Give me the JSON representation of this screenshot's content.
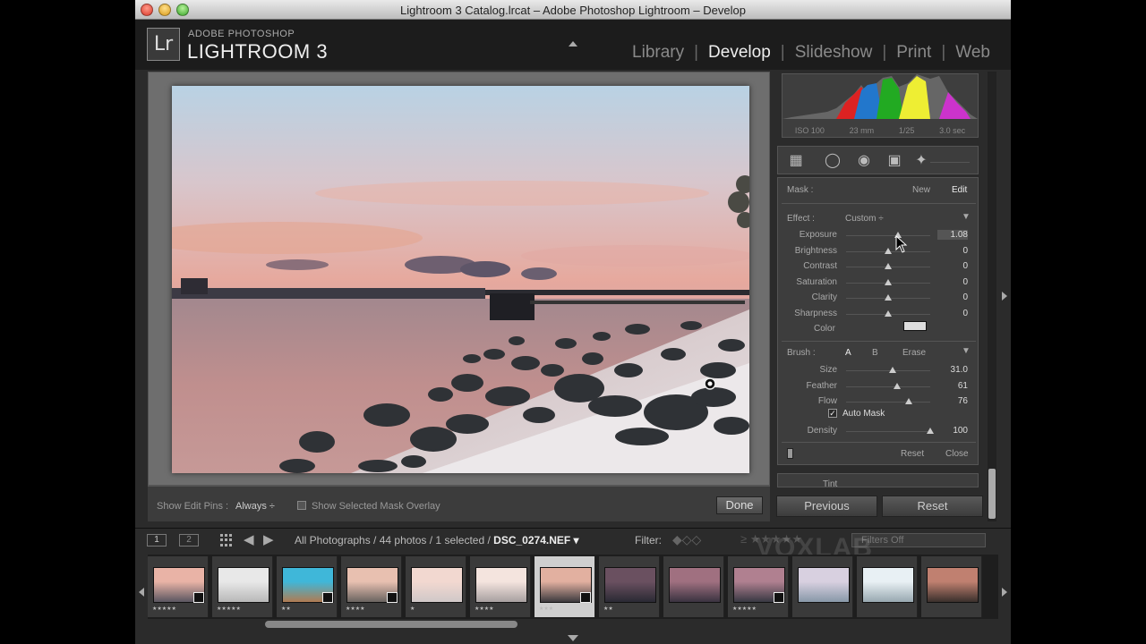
{
  "window": {
    "title": "Lightroom 3 Catalog.lrcat – Adobe Photoshop Lightroom – Develop"
  },
  "brand": {
    "logo": "Lr",
    "small": "ADOBE PHOTOSHOP",
    "big": "LIGHTROOM 3"
  },
  "modules": [
    {
      "label": "Library",
      "active": false
    },
    {
      "label": "Develop",
      "active": true
    },
    {
      "label": "Slideshow",
      "active": false
    },
    {
      "label": "Print",
      "active": false
    },
    {
      "label": "Web",
      "active": false
    }
  ],
  "histogram": {
    "iso": "ISO 100",
    "focal": "23 mm",
    "aperture": "1/25",
    "shutter": "3.0 sec"
  },
  "mask": {
    "label": "Mask :",
    "new": "New",
    "edit": "Edit"
  },
  "effect": {
    "label": "Effect :",
    "value": "Custom ÷"
  },
  "sliders": [
    {
      "label": "Exposure",
      "value": "1.08",
      "pos": 0.62
    },
    {
      "label": "Brightness",
      "value": "0",
      "pos": 0.5
    },
    {
      "label": "Contrast",
      "value": "0",
      "pos": 0.5
    },
    {
      "label": "Saturation",
      "value": "0",
      "pos": 0.5
    },
    {
      "label": "Clarity",
      "value": "0",
      "pos": 0.5
    },
    {
      "label": "Sharpness",
      "value": "0",
      "pos": 0.5
    }
  ],
  "color_label": "Color",
  "brush": {
    "label": "Brush :",
    "a": "A",
    "b": "B",
    "erase": "Erase"
  },
  "brush_sliders": [
    {
      "label": "Size",
      "value": "31.0",
      "pos": 0.55
    },
    {
      "label": "Feather",
      "value": "61",
      "pos": 0.61
    },
    {
      "label": "Flow",
      "value": "76",
      "pos": 0.74
    }
  ],
  "auto_mask": {
    "label": "Auto Mask",
    "checked": "✓"
  },
  "density": {
    "label": "Density",
    "value": "100",
    "pos": 1.0
  },
  "panel_buttons": {
    "reset": "Reset",
    "close": "Close"
  },
  "tint_label": "Tint",
  "buttons": {
    "previous": "Previous",
    "reset": "Reset",
    "done": "Done"
  },
  "toolbar": {
    "show_edit_pins": "Show Edit Pins :",
    "edit_pins_value": "Always ÷",
    "mask_overlay": "Show Selected Mask Overlay"
  },
  "filmbar": {
    "mon1": "1",
    "mon2": "2",
    "source_prefix": "All Photographs / 44 photos / 1 selected /",
    "source_file": "DSC_0274.NEF ▾",
    "filter_label": "Filter:",
    "filters_off": "Filters Off",
    "flags": "◆◇◇",
    "stars": "≥ ★★★★★"
  },
  "watermark": "VOXLAB",
  "filmstrip": [
    {
      "stars": "★★★★★",
      "badge": true,
      "colors": [
        "#e9b3a6",
        "#5a5660"
      ]
    },
    {
      "stars": "★★★★★",
      "badge": false,
      "colors": [
        "#e8e8e8",
        "#b8b8b8"
      ]
    },
    {
      "stars": "★★",
      "badge": true,
      "colors": [
        "#3fb7d9",
        "#b07b52"
      ]
    },
    {
      "stars": "★★★★",
      "badge": true,
      "colors": [
        "#e8c0b0",
        "#6a6460"
      ]
    },
    {
      "stars": "★",
      "badge": false,
      "colors": [
        "#f2d8d0",
        "#d0c8c8"
      ]
    },
    {
      "stars": "★★★★",
      "badge": false,
      "colors": [
        "#f4e4de",
        "#a8a0a0"
      ]
    },
    {
      "stars": "★★★",
      "badge": true,
      "colors": [
        "#e2b0a0",
        "#3c3a3e"
      ]
    },
    {
      "stars": "★★",
      "badge": false,
      "colors": [
        "#6a5060",
        "#2a2a34"
      ]
    },
    {
      "stars": "",
      "badge": false,
      "colors": [
        "#a07080",
        "#3a3340"
      ]
    },
    {
      "stars": "★★★★★",
      "badge": true,
      "colors": [
        "#b08090",
        "#383842"
      ]
    },
    {
      "stars": "",
      "badge": false,
      "colors": [
        "#d8d0e0",
        "#8898a8"
      ]
    },
    {
      "stars": "",
      "badge": false,
      "colors": [
        "#e8f0f4",
        "#98a8b0"
      ]
    },
    {
      "stars": "",
      "badge": false,
      "colors": [
        "#c08070",
        "#3a302c"
      ]
    }
  ],
  "selected_index": 6
}
